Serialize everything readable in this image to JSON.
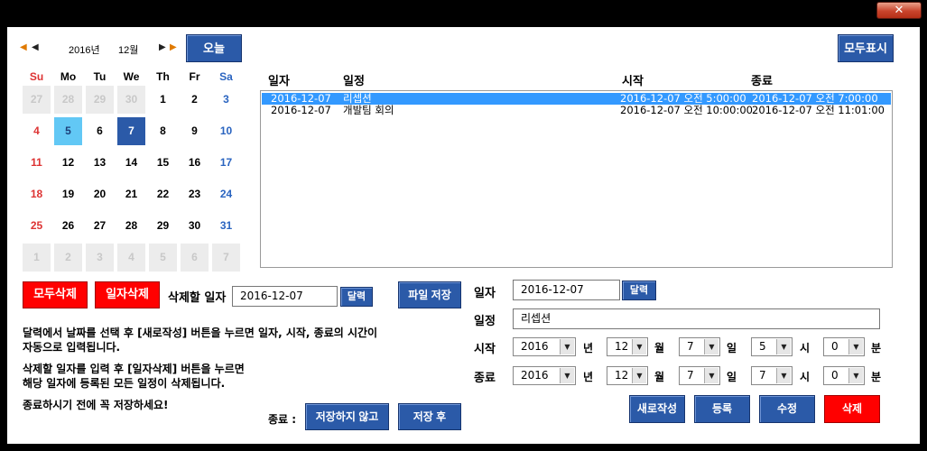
{
  "window": {
    "close_label": "✕"
  },
  "calendar": {
    "year_label": "2016년",
    "month_label": "12월",
    "today_button": "오늘",
    "weekdays": [
      "Su",
      "Mo",
      "Tu",
      "We",
      "Th",
      "Fr",
      "Sa"
    ],
    "weeks": [
      [
        "27",
        "28",
        "29",
        "30",
        "1",
        "2",
        "3"
      ],
      [
        "4",
        "5",
        "6",
        "7",
        "8",
        "9",
        "10"
      ],
      [
        "11",
        "12",
        "13",
        "14",
        "15",
        "16",
        "17"
      ],
      [
        "18",
        "19",
        "20",
        "21",
        "22",
        "23",
        "24"
      ],
      [
        "25",
        "26",
        "27",
        "28",
        "29",
        "30",
        "31"
      ],
      [
        "1",
        "2",
        "3",
        "4",
        "5",
        "6",
        "7"
      ]
    ],
    "highlighted_day": "5",
    "selected_day": "7"
  },
  "show_all_button": "모두표시",
  "schedule_list": {
    "headers": {
      "date": "일자",
      "title": "일정",
      "start": "시작",
      "end": "종료"
    },
    "rows": [
      {
        "date": "2016-12-07",
        "title": "리셉션",
        "start": "2016-12-07 오전 5:00:00",
        "end": "2016-12-07 오전 7:00:00",
        "selected": true
      },
      {
        "date": "2016-12-07",
        "title": "개발팀 회의",
        "start": "2016-12-07 오전 10:00:00",
        "end": "2016-12-07 오전 11:01:00",
        "selected": false
      }
    ]
  },
  "delete_area": {
    "delete_all_button": "모두삭제",
    "delete_date_button": "일자삭제",
    "date_label": "삭제할 일자",
    "date_value": "2016-12-07",
    "calendar_button": "달력",
    "save_file_button": "파일 저장"
  },
  "help": {
    "line1": "달력에서 날짜를 선택 후 [새로작성] 버튼을 누르면 일자, 시작, 종료의 시간이",
    "line2": "자동으로 입력됩니다.",
    "line3": "삭제할 일자를 입력 후 [일자삭제] 버튼을 누르면",
    "line4": "해당 일자에 등록된 모든 일정이 삭제됩니다.",
    "line5": "종료하시기 전에 꼭 저장하세요!"
  },
  "exit": {
    "label": "종료 :",
    "no_save_button": "저장하지 않고",
    "after_save_button": "저장 후"
  },
  "form": {
    "date_label": "일자",
    "date_value": "2016-12-07",
    "calendar_button": "달력",
    "title_label": "일정",
    "title_value": "리셉션",
    "start_label": "시작",
    "end_label": "종료",
    "year_unit": "년",
    "month_unit": "월",
    "day_unit": "일",
    "hour_unit": "시",
    "minute_unit": "분",
    "start": {
      "year": "2016",
      "month": "12",
      "day": "7",
      "hour": "5",
      "minute": "0"
    },
    "end": {
      "year": "2016",
      "month": "12",
      "day": "7",
      "hour": "7",
      "minute": "0"
    },
    "new_button": "새로작성",
    "register_button": "등록",
    "edit_button": "수정",
    "delete_button": "삭제"
  }
}
